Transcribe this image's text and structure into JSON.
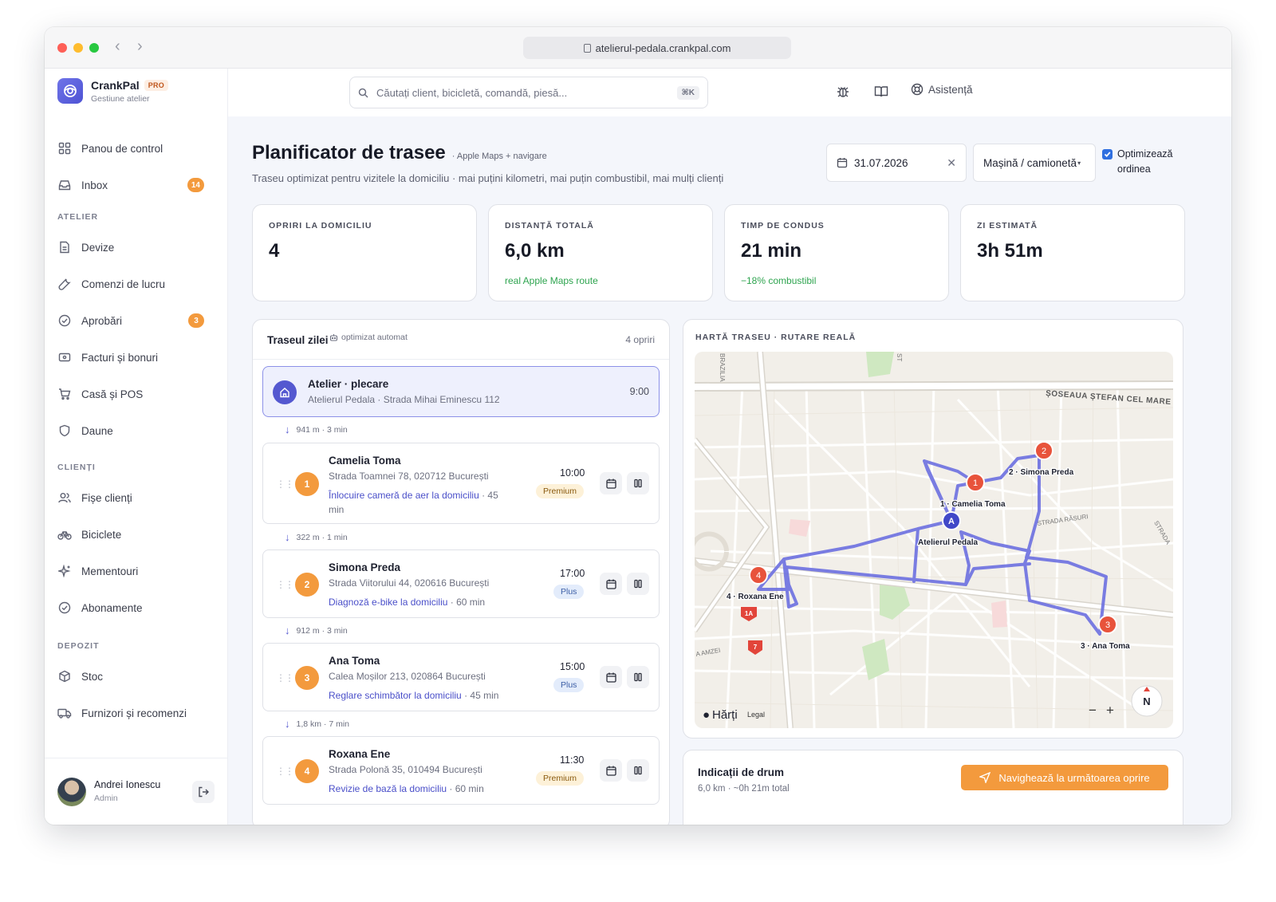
{
  "browser": {
    "url": "atelierul-pedala.crankpal.com"
  },
  "brand": {
    "name": "CrankPal",
    "badge": "PRO",
    "subtitle": "Gestiune atelier"
  },
  "search": {
    "placeholder": "Căutați client, bicicletă, comandă, piesă...",
    "shortcut": "⌘K"
  },
  "topbar": {
    "help_label": "Asistență"
  },
  "sidebar": {
    "main": [
      {
        "label": "Panou de control",
        "icon": "dashboard-icon"
      },
      {
        "label": "Inbox",
        "icon": "inbox-icon",
        "badge": "14"
      }
    ],
    "section_atelier": "ATELIER",
    "atelier": [
      {
        "label": "Devize",
        "icon": "document-icon"
      },
      {
        "label": "Comenzi de lucru",
        "icon": "wrench-icon"
      },
      {
        "label": "Aprobări",
        "icon": "check-circle-icon",
        "badge": "3"
      },
      {
        "label": "Facturi și bonuri",
        "icon": "invoice-icon"
      },
      {
        "label": "Casă și POS",
        "icon": "cart-icon"
      },
      {
        "label": "Daune",
        "icon": "shield-icon"
      }
    ],
    "section_clienti": "CLIENȚI",
    "clienti": [
      {
        "label": "Fișe clienți",
        "icon": "users-icon"
      },
      {
        "label": "Biciclete",
        "icon": "bicycle-icon"
      },
      {
        "label": "Mementouri",
        "icon": "sparkle-icon"
      },
      {
        "label": "Abonamente",
        "icon": "check-circle-icon"
      }
    ],
    "section_depozit": "DEPOZIT",
    "depozit": [
      {
        "label": "Stoc",
        "icon": "box-icon"
      },
      {
        "label": "Furnizori și recomenzi",
        "icon": "truck-icon"
      }
    ]
  },
  "user": {
    "name": "Andrei Ionescu",
    "role": "Admin"
  },
  "page": {
    "title": "Planificator de trasee",
    "title_tag": "· Apple Maps + navigare",
    "subtitle": "Traseu optimizat pentru vizitele la domiciliu · mai puțini kilometri, mai puțin combustibil, mai mulți clienți",
    "date": "31.07.2026",
    "vehicle": "Mașină / camionetă",
    "optimize_label_1": "Optimizează",
    "optimize_label_2": "ordinea",
    "optimize_checked": true
  },
  "stats": [
    {
      "label": "OPRIRI LA DOMICILIU",
      "value": "4",
      "note": ""
    },
    {
      "label": "DISTANȚĂ TOTALĂ",
      "value": "6,0 km",
      "note": "real Apple Maps route"
    },
    {
      "label": "TIMP DE CONDUS",
      "value": "21 min",
      "note": "−18% combustibil"
    },
    {
      "label": "ZI ESTIMATĂ",
      "value": "3h 51m",
      "note": ""
    }
  ],
  "route": {
    "title": "Traseul zilei",
    "auto_label": "optimizat automat",
    "count": "4 opriri",
    "depot": {
      "title": "Atelier · plecare",
      "address": "Atelierul Pedala · Strada Mihai Eminescu 112",
      "time": "9:00"
    },
    "legs": [
      "941 m · 3 min",
      "322 m · 1 min",
      "912 m · 3 min",
      "1,8 km · 7 min"
    ],
    "stops": [
      {
        "num": "1",
        "name": "Camelia Toma",
        "address": "Strada Toamnei 78, 020712 București",
        "task": "Înlocuire cameră de aer la domiciliu",
        "duration": " · 45 min",
        "time": "10:00",
        "tier": "Premium"
      },
      {
        "num": "2",
        "name": "Simona Preda",
        "address": "Strada Viitorului 44, 020616 București",
        "task": "Diagnoză e-bike la domiciliu",
        "duration": " · 60 min",
        "time": "17:00",
        "tier": "Plus"
      },
      {
        "num": "3",
        "name": "Ana Toma",
        "address": "Calea Moșilor 213, 020864 București",
        "task": "Reglare schimbător la domiciliu",
        "duration": " · 45 min",
        "time": "15:00",
        "tier": "Plus"
      },
      {
        "num": "4",
        "name": "Roxana Ene",
        "address": "Strada Polonă 35, 010494 București",
        "task": "Revizie de bază la domiciliu",
        "duration": " · 60 min",
        "time": "11:30",
        "tier": "Premium"
      }
    ]
  },
  "map": {
    "label": "HARTĂ TRASEU · RUTARE REALĂ",
    "streets": [
      "ȘOSEAUA ȘTEFAN CEL MARE",
      "STRADA RĂSURI",
      "BRAZILIA",
      "A AMZEI",
      "STRADA",
      "ST"
    ],
    "route_shields": [
      "1A",
      "7"
    ],
    "depot_marker": "A",
    "depot_label": "Atelierul Pedala",
    "markers": [
      {
        "num": "1",
        "label": "1 · Camelia Toma"
      },
      {
        "num": "2",
        "label": "2 · Simona Preda"
      },
      {
        "num": "3",
        "label": "3 · Ana Toma"
      },
      {
        "num": "4",
        "label": "4 · Roxana Ene"
      }
    ],
    "attribution": "Hărți",
    "legal": "Legal",
    "compass": "N",
    "zoom_out": "−",
    "zoom_in": "+"
  },
  "directions": {
    "title": "Indicații de drum",
    "subtitle": "6,0 km · ~0h 21m total",
    "button": "Navighează la următoarea oprire"
  },
  "colors": {
    "accent": "#5458d0",
    "orange": "#f39a3d",
    "route": "#6b6fe0",
    "green": "#2ea44f"
  }
}
